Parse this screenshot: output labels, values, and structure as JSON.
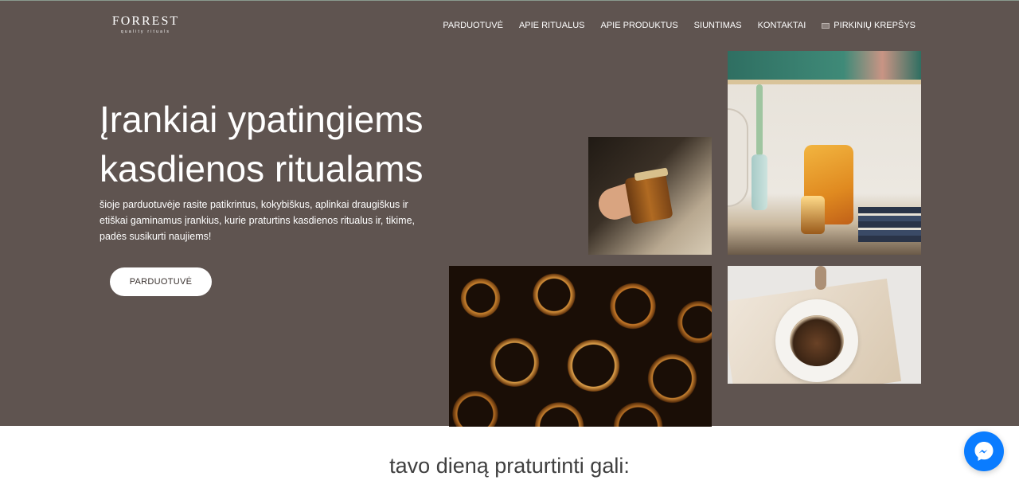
{
  "logo": {
    "title": "FORREST",
    "subtitle": "quality rituals"
  },
  "nav": {
    "items": [
      {
        "label": "PARDUOTUVĖ"
      },
      {
        "label": "APIE RITUALUS"
      },
      {
        "label": "APIE PRODUKTUS"
      },
      {
        "label": "SIUNTIMAS"
      },
      {
        "label": "KONTAKTAI"
      }
    ],
    "cart": {
      "label": "PIRKINIŲ KREPŠYS",
      "icon": "cart-icon"
    }
  },
  "hero": {
    "headline": "Įrankiai ypatingiems kasdienos ritualams",
    "text": "šioje parduotuvėje rasite patikrintus, kokybiškus, aplinkai draugiškus ir etiškai gaminamus įrankius, kurie praturtins kasdienos ritualus ir, tikime, padės susikurti naujiems!",
    "button_label": "PARDUOTUVĖ",
    "background_color": "#5f5450"
  },
  "section": {
    "title": "tavo dieną praturtinti gali:"
  },
  "chat": {
    "icon": "messenger-icon",
    "color": "#0a7cff"
  }
}
